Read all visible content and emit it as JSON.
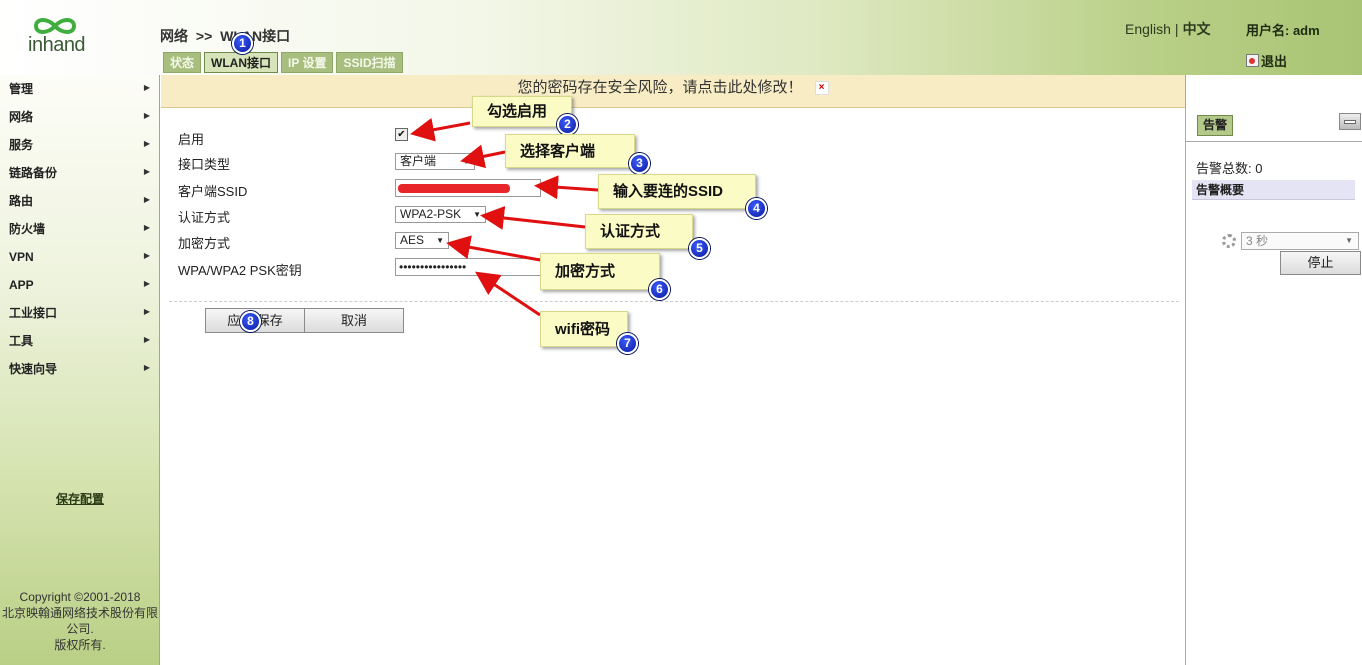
{
  "header": {
    "logo_text": "inhand",
    "breadcrumb": {
      "section": "网络",
      "separator": ">>",
      "page": "WLAN接口"
    },
    "tabs": [
      {
        "label": "状态"
      },
      {
        "label": "WLAN接口"
      },
      {
        "label": "IP 设置"
      },
      {
        "label": "SSID扫描"
      }
    ],
    "lang_en": "English",
    "lang_sep": "|",
    "lang_cn": "中文",
    "username": "用户名: adm",
    "logout": "退出"
  },
  "sidebar": {
    "items": [
      {
        "label": "管理"
      },
      {
        "label": "网络"
      },
      {
        "label": "服务"
      },
      {
        "label": "链路备份"
      },
      {
        "label": "路由"
      },
      {
        "label": "防火墙"
      },
      {
        "label": "VPN"
      },
      {
        "label": "APP"
      },
      {
        "label": "工业接口"
      },
      {
        "label": "工具"
      },
      {
        "label": "快速向导"
      }
    ],
    "arrow": "▶",
    "save_config": "保存配置",
    "copyright": [
      "Copyright ©2001-2018",
      "北京映翰通网络技术股份有限",
      "公司.",
      "版权所有."
    ]
  },
  "main": {
    "warning": "您的密码存在安全风险，请点击此处修改！",
    "warning_close": "×",
    "form": {
      "enable_label": "启用",
      "enable_checked": true,
      "enable_mark": "✔",
      "iface_type_label": "接口类型",
      "iface_type_value": "客户端",
      "ssid_label": "客户端SSID",
      "auth_label": "认证方式",
      "auth_value": "WPA2-PSK",
      "enc_label": "加密方式",
      "enc_value": "AES",
      "psk_label": "WPA/WPA2 PSK密钥",
      "psk_value": "••••••••••••••••",
      "dropdown_arrow": "▼"
    },
    "buttons": {
      "apply": "应用 保存",
      "cancel": "取消"
    }
  },
  "right_panel": {
    "tab": "告警",
    "alarm_total": "告警总数: 0",
    "alarm_summary": "告警概要",
    "refresh_value": "3 秒",
    "stop": "停止"
  },
  "annotations": [
    {
      "num": "1"
    },
    {
      "num": "2",
      "text": "勾选启用"
    },
    {
      "num": "3",
      "text": "选择客户端"
    },
    {
      "num": "4",
      "text": "输入要连的SSID"
    },
    {
      "num": "5",
      "text": "认证方式"
    },
    {
      "num": "6",
      "text": "加密方式"
    },
    {
      "num": "7",
      "text": "wifi密码"
    },
    {
      "num": "8"
    }
  ],
  "colors": {
    "header_green": "#a9c474",
    "warning_bg": "#f7ecc4",
    "annotation_arrow": "#e01010",
    "callout_bg": "#fbfbc6",
    "badge_blue": "#0a1a9a"
  }
}
